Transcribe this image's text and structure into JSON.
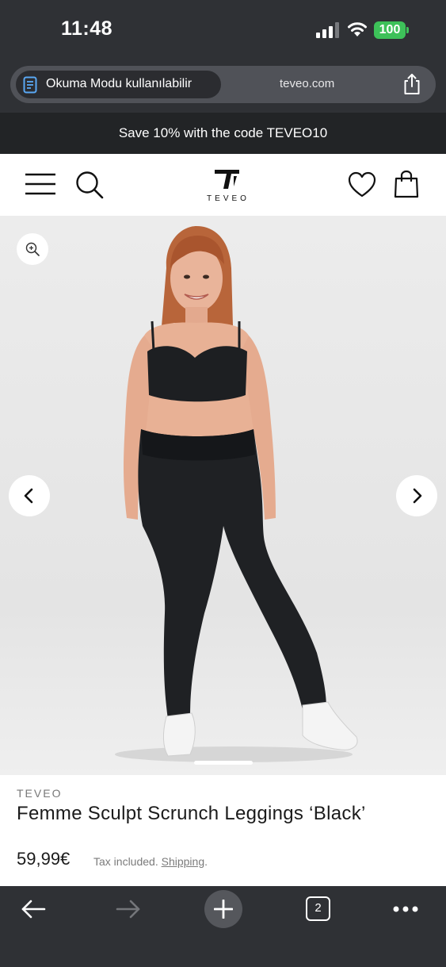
{
  "status_bar": {
    "time": "11:48",
    "battery": "100"
  },
  "browser": {
    "reader_mode_label": "Okuma Modu kullanılabilir",
    "url": "teveo.com",
    "open_tabs": "2"
  },
  "promo": {
    "text": "Save 10% with the code TEVEO10"
  },
  "header": {
    "logo_text": "TEVEO"
  },
  "product": {
    "brand": "TEVEO",
    "title": "Femme Sculpt Scrunch Leggings ‘Black’",
    "price": "59,99€",
    "tax_note": "Tax included.",
    "shipping_link": "Shipping"
  },
  "icons": {
    "menu": "hamburger-menu-icon",
    "search": "search-icon",
    "wishlist": "heart-icon",
    "cart": "shopping-bag-icon",
    "zoom": "zoom-in-icon",
    "prev": "chevron-left-icon",
    "next": "chevron-right-icon",
    "reader": "reader-mode-icon",
    "share": "share-icon",
    "back": "arrow-left-icon",
    "forward": "arrow-right-icon",
    "new_tab": "plus-icon",
    "tabs": "tabs-icon",
    "more": "more-icon"
  },
  "colors": {
    "battery": "#3dc159",
    "browser_chrome": "#2f3135",
    "promo_bg": "#222426",
    "text": "#1b1b1b"
  }
}
